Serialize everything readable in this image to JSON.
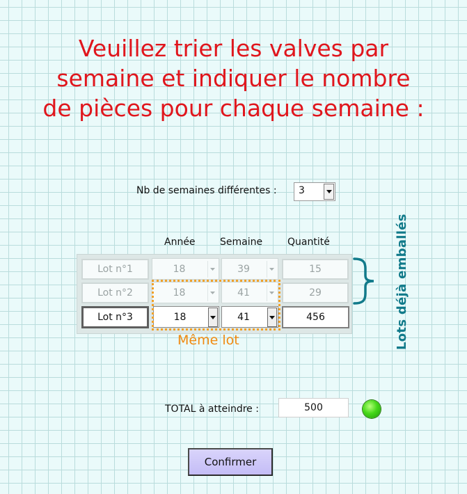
{
  "title": {
    "line1": "Veuillez trier les valves par",
    "line2": "semaine et indiquer le nombre",
    "line3": "de pièces pour chaque semaine :"
  },
  "nb_weeks": {
    "label": "Nb de semaines différentes :",
    "value": "3"
  },
  "columns": {
    "year": "Année",
    "week": "Semaine",
    "quantity": "Quantité"
  },
  "rows": [
    {
      "lot": "Lot n°1",
      "year": "18",
      "week": "39",
      "quantity": "15"
    },
    {
      "lot": "Lot n°2",
      "year": "18",
      "week": "41",
      "quantity": "29"
    },
    {
      "lot": "Lot n°3",
      "year": "18",
      "week": "41",
      "quantity": "456"
    }
  ],
  "same_lot_label": "Même lot",
  "side_label": "Lots déjà emballés",
  "total": {
    "label": "TOTAL à atteindre :",
    "value": "500"
  },
  "status_led_color": "#46d81a",
  "confirm_label": "Confirmer",
  "colors": {
    "title": "#e0161d",
    "same_lot": "#f08a10",
    "side_label": "#117a8a",
    "confirm_bg": "#c9c1f8"
  }
}
